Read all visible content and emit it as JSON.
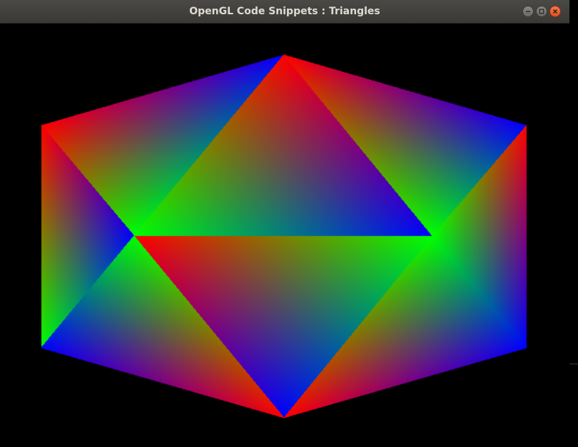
{
  "window": {
    "title": "OpenGL Code Snippets : Triangles",
    "buttons": {
      "minimize_icon": "minimize-icon",
      "maximize_icon": "maximize-icon",
      "close_icon": "close-icon"
    }
  },
  "scene": {
    "background": "#000000",
    "vertex_colors": {
      "red": "#ff0000",
      "green": "#00ff00",
      "blue": "#0000ff"
    }
  }
}
